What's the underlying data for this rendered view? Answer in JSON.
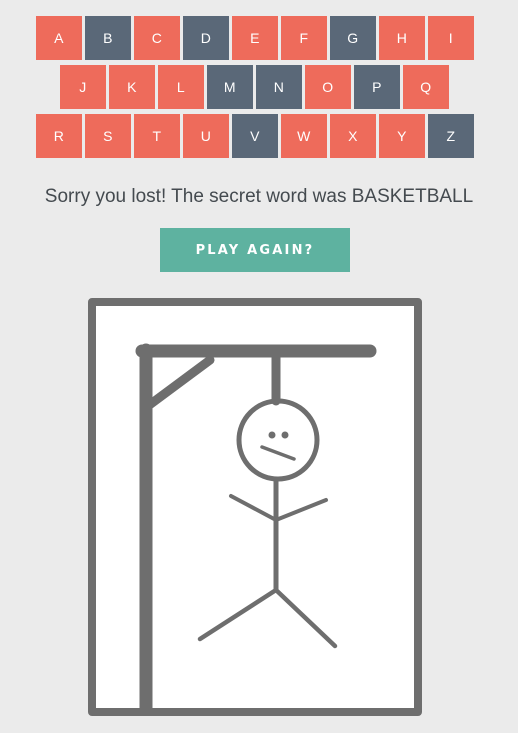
{
  "keyboard": {
    "rows": [
      [
        {
          "letter": "A",
          "state": "unused"
        },
        {
          "letter": "B",
          "state": "used"
        },
        {
          "letter": "C",
          "state": "unused"
        },
        {
          "letter": "D",
          "state": "used"
        },
        {
          "letter": "E",
          "state": "unused"
        },
        {
          "letter": "F",
          "state": "unused"
        },
        {
          "letter": "G",
          "state": "used"
        },
        {
          "letter": "H",
          "state": "unused"
        },
        {
          "letter": "I",
          "state": "unused"
        }
      ],
      [
        {
          "letter": "J",
          "state": "unused"
        },
        {
          "letter": "K",
          "state": "unused"
        },
        {
          "letter": "L",
          "state": "unused"
        },
        {
          "letter": "M",
          "state": "used"
        },
        {
          "letter": "N",
          "state": "used"
        },
        {
          "letter": "O",
          "state": "unused"
        },
        {
          "letter": "P",
          "state": "used"
        },
        {
          "letter": "Q",
          "state": "unused"
        }
      ],
      [
        {
          "letter": "R",
          "state": "unused"
        },
        {
          "letter": "S",
          "state": "unused"
        },
        {
          "letter": "T",
          "state": "unused"
        },
        {
          "letter": "U",
          "state": "unused"
        },
        {
          "letter": "V",
          "state": "used"
        },
        {
          "letter": "W",
          "state": "unused"
        },
        {
          "letter": "X",
          "state": "unused"
        },
        {
          "letter": "Y",
          "state": "unused"
        },
        {
          "letter": "Z",
          "state": "used"
        }
      ]
    ]
  },
  "game": {
    "message": "Sorry you lost! The secret word was BASKETBALL",
    "play_again_label": "PLAY AGAIN?"
  },
  "colors": {
    "background": "#ebebeb",
    "key_unused": "#ee6b5b",
    "key_used": "#5a6878",
    "play_again": "#5eb2a0",
    "drawing_stroke": "#6e6e6e",
    "message_text": "#444a4f"
  }
}
